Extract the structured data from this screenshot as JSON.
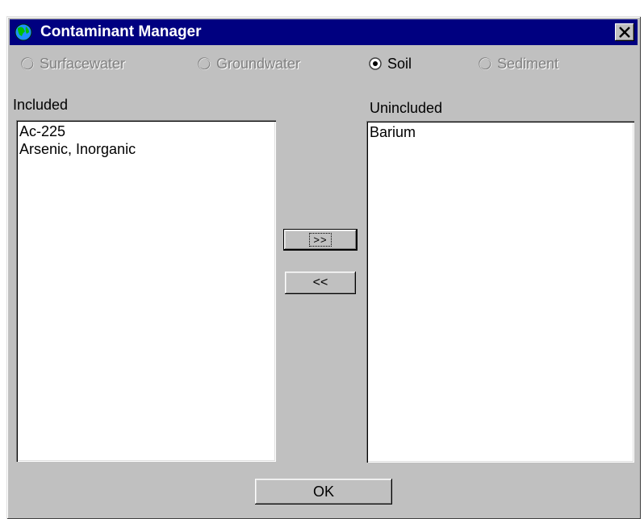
{
  "window": {
    "title": "Contaminant Manager",
    "close_icon": "close-icon",
    "app_icon": "globe-icon",
    "accent_color": "#000080"
  },
  "media": {
    "options": [
      {
        "label": "Surfacewater",
        "enabled": false,
        "selected": false
      },
      {
        "label": "Groundwater",
        "enabled": false,
        "selected": false
      },
      {
        "label": "Soil",
        "enabled": true,
        "selected": true
      },
      {
        "label": "Sediment",
        "enabled": false,
        "selected": false
      }
    ]
  },
  "included": {
    "label": "Included",
    "items": [
      "Ac-225",
      "Arsenic, Inorganic"
    ]
  },
  "unincluded": {
    "label": "Unincluded",
    "items": [
      "Barium"
    ]
  },
  "buttons": {
    "move_right_label": ">>",
    "move_left_label": "<<",
    "ok_label": "OK"
  }
}
